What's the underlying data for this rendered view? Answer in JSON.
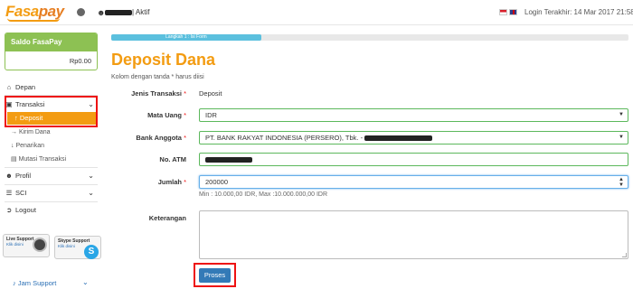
{
  "header": {
    "logo_text_1": "Fasa",
    "logo_text_2": "pay",
    "user_status": "| Aktif",
    "last_login": "Login Terakhir: 14 Mar 2017 21:58",
    "icons": [
      "globe-icon",
      "user-icon",
      "flag-indonesia-icon",
      "flag-uk-icon"
    ]
  },
  "sidebar": {
    "saldo_title": "Saldo FasaPay",
    "saldo_value": "Rp0.00",
    "depan": "Depan",
    "transaksi": "Transaksi",
    "deposit": "Deposit",
    "kirim_dana": "Kirim Dana",
    "penarikan": "Penarikan",
    "mutasi_transaksi": "Mutasi Transaksi",
    "profil": "Profil",
    "sci": "SCI",
    "logout": "Logout",
    "live_support_title": "Live Support",
    "live_support_link": "Klik disini",
    "skype_support_title": "Skype Support",
    "skype_support_link": "Klik disini",
    "jam_support": "Jam Support"
  },
  "main": {
    "step_label": "Langkah 1 : Isi Form",
    "step_progress": 0.29,
    "title": "Deposit Dana",
    "required_note": "Kolom dengan tanda * harus diisi",
    "jenis_transaksi_label": "Jenis Transaksi",
    "jenis_transaksi_value": "Deposit",
    "mata_uang_label": "Mata Uang",
    "mata_uang_value": "IDR",
    "bank_anggota_label": "Bank Anggota",
    "bank_anggota_value": "PT. BANK RAKYAT INDONESIA (PERSERO), Tbk. -",
    "no_atm_label": "No. ATM",
    "jumlah_label": "Jumlah",
    "jumlah_value": "200000",
    "jumlah_hint": "Min : 10.000,00 IDR, Max :10.000.000,00 IDR",
    "keterangan_label": "Keterangan",
    "submit_label": "Proses",
    "required_mark": "*"
  },
  "colors": {
    "brand_orange": "#f39c12",
    "saldo_green": "#8dc153",
    "button_blue": "#337ab7",
    "highlight_red": "#e11111"
  }
}
